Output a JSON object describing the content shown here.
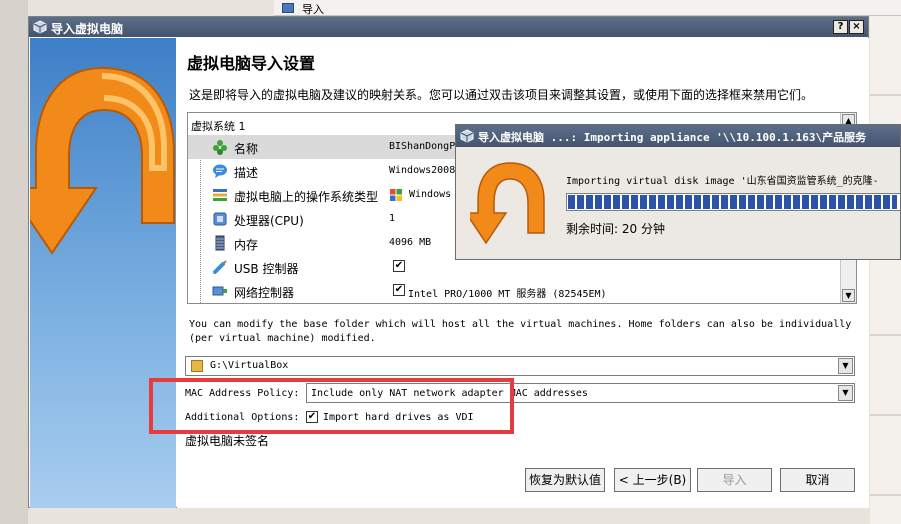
{
  "background": {
    "top_window_text": "导入"
  },
  "dialog": {
    "title": "导入虚拟电脑",
    "help_button": "?",
    "close_button": "×",
    "heading": "虚拟电脑导入设置",
    "description": "这是即将导入的虚拟电脑及建议的映射关系。您可以通过双击该项目来调整其设置，或使用下面的选择框来禁用它们。",
    "tree": {
      "root": "虚拟系统 1",
      "rows": [
        {
          "icon": "green-puzzle-icon",
          "name": "名称",
          "value": "BIShanDongP",
          "selected": true
        },
        {
          "icon": "speech-bubble-icon",
          "name": "描述",
          "value": "Windows2008"
        },
        {
          "icon": "os-type-icon",
          "name": "虚拟电脑上的操作系统类型",
          "value": "Windows"
        },
        {
          "icon": "cpu-icon",
          "name": "处理器(CPU)",
          "value": "1"
        },
        {
          "icon": "memory-icon",
          "name": "内存",
          "value": "4096 MB"
        },
        {
          "icon": "usb-icon",
          "name": "USB 控制器",
          "value": "",
          "checked": true
        },
        {
          "icon": "network-icon",
          "name": "网络控制器",
          "value": "Intel PRO/1000 MT 服务器 (82545EM)",
          "checked": true
        }
      ]
    },
    "base_folder_note": "You can modify the base folder which will host all the virtual machines. Home folders can also be individually (per virtual machine) modified.",
    "base_folder": "G:\\VirtualBox",
    "mac_policy_label": "MAC Address Policy:",
    "mac_policy_value": "Include only NAT network adapter MAC addresses",
    "additional_options_label": "Additional Options:",
    "import_vdi_label": "Import hard drives as VDI",
    "import_vdi_checked": true,
    "unsigned_note": "虚拟电脑未签名",
    "buttons": {
      "restore_defaults": "恢复为默认值",
      "back": "< 上一步(B)",
      "import": "导入",
      "cancel": "取消"
    }
  },
  "progress_dialog": {
    "title": "导入虚拟电脑 ...: Importing appliance '\\\\10.100.1.163\\产品服务",
    "status": "Importing virtual disk image '山东省国资监管系统_的克隆-",
    "progress": 0.98,
    "remaining": "剩余时间:  20 分钟"
  },
  "colors": {
    "titlebar": "#4f607b",
    "highlight": "#e83c3c",
    "progress_fill": "#2b53a8",
    "arrow_orange": "#f28a1a"
  }
}
